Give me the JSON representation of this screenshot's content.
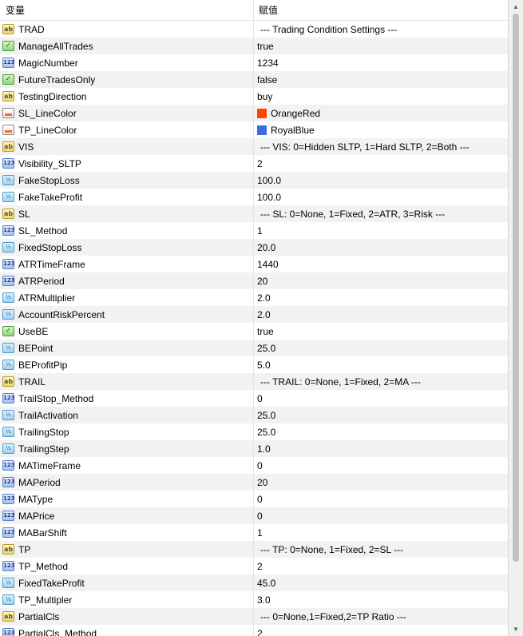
{
  "headers": {
    "variable": "变量",
    "value": "赋值"
  },
  "rows": [
    {
      "type": "str",
      "name": "TRAD",
      "value": "--- Trading Condition Settings ---"
    },
    {
      "type": "bool",
      "name": "ManageAllTrades",
      "value": "true"
    },
    {
      "type": "int",
      "name": "MagicNumber",
      "value": "1234"
    },
    {
      "type": "bool",
      "name": "FutureTradesOnly",
      "value": "false"
    },
    {
      "type": "str",
      "name": "TestingDirection",
      "value": "buy"
    },
    {
      "type": "clr",
      "name": "SL_LineColor",
      "value": "OrangeRed",
      "color": "#ff4500"
    },
    {
      "type": "clr",
      "name": "TP_LineColor",
      "value": "RoyalBlue",
      "color": "#4169e1"
    },
    {
      "type": "str",
      "name": "VIS",
      "value": "--- VIS: 0=Hidden SLTP, 1=Hard SLTP, 2=Both ---"
    },
    {
      "type": "int",
      "name": "Visibility_SLTP",
      "value": "2"
    },
    {
      "type": "dbl",
      "name": "FakeStopLoss",
      "value": "100.0"
    },
    {
      "type": "dbl",
      "name": "FakeTakeProfit",
      "value": "100.0"
    },
    {
      "type": "str",
      "name": "SL",
      "value": "--- SL: 0=None, 1=Fixed, 2=ATR, 3=Risk ---"
    },
    {
      "type": "int",
      "name": "SL_Method",
      "value": "1"
    },
    {
      "type": "dbl",
      "name": "FixedStopLoss",
      "value": "20.0"
    },
    {
      "type": "int",
      "name": "ATRTimeFrame",
      "value": "1440"
    },
    {
      "type": "int",
      "name": "ATRPeriod",
      "value": "20"
    },
    {
      "type": "dbl",
      "name": "ATRMultiplier",
      "value": "2.0"
    },
    {
      "type": "dbl",
      "name": "AccountRiskPercent",
      "value": "2.0"
    },
    {
      "type": "bool",
      "name": "UseBE",
      "value": "true"
    },
    {
      "type": "dbl",
      "name": "BEPoint",
      "value": "25.0"
    },
    {
      "type": "dbl",
      "name": "BEProfitPip",
      "value": "5.0"
    },
    {
      "type": "str",
      "name": "TRAIL",
      "value": "--- TRAIL: 0=None, 1=Fixed, 2=MA ---"
    },
    {
      "type": "int",
      "name": "TrailStop_Method",
      "value": "0"
    },
    {
      "type": "dbl",
      "name": "TrailActivation",
      "value": "25.0"
    },
    {
      "type": "dbl",
      "name": "TrailingStop",
      "value": "25.0"
    },
    {
      "type": "dbl",
      "name": "TrailingStep",
      "value": "1.0"
    },
    {
      "type": "int",
      "name": "MATimeFrame",
      "value": "0"
    },
    {
      "type": "int",
      "name": "MAPeriod",
      "value": "20"
    },
    {
      "type": "int",
      "name": "MAType",
      "value": "0"
    },
    {
      "type": "int",
      "name": "MAPrice",
      "value": "0"
    },
    {
      "type": "int",
      "name": "MABarShift",
      "value": "1"
    },
    {
      "type": "str",
      "name": "TP",
      "value": "--- TP: 0=None, 1=Fixed, 2=SL ---"
    },
    {
      "type": "int",
      "name": "TP_Method",
      "value": "2"
    },
    {
      "type": "dbl",
      "name": "FixedTakeProfit",
      "value": "45.0"
    },
    {
      "type": "dbl",
      "name": "TP_Multipler",
      "value": "3.0"
    },
    {
      "type": "str",
      "name": "PartialCls",
      "value": "--- 0=None,1=Fixed,2=TP Ratio ---"
    },
    {
      "type": "int",
      "name": "PartialCls_Method",
      "value": "2"
    }
  ],
  "icon_glyphs": {
    "str": "ab",
    "bool": "✓",
    "int": "123",
    "dbl": "½",
    "clr": ""
  },
  "icon_names": {
    "str": "string-type-icon",
    "bool": "bool-type-icon",
    "int": "integer-type-icon",
    "dbl": "double-type-icon",
    "clr": "color-type-icon"
  },
  "scrollbar": {
    "up_icon": "scroll-up-arrow-icon",
    "down_icon": "scroll-down-arrow-icon"
  }
}
